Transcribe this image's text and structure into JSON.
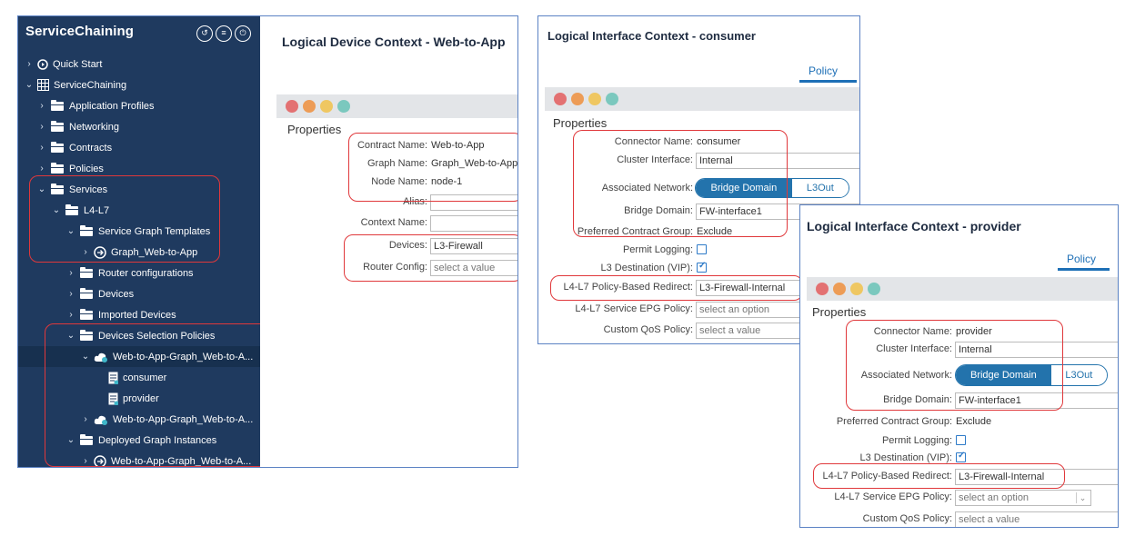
{
  "tree": {
    "title": "ServiceChaining",
    "toolbar_icons": [
      "refresh-settings-icon",
      "list-icon",
      "power-icon"
    ],
    "items": [
      {
        "label": "Quick Start",
        "icon": "play-icon",
        "chevron": "right"
      },
      {
        "label": "ServiceChaining",
        "icon": "grid-icon",
        "chevron": "down"
      },
      {
        "label": "Application Profiles",
        "icon": "folder-icon",
        "chevron": "right"
      },
      {
        "label": "Networking",
        "icon": "folder-icon",
        "chevron": "right"
      },
      {
        "label": "Contracts",
        "icon": "folder-icon",
        "chevron": "right"
      },
      {
        "label": "Policies",
        "icon": "folder-icon",
        "chevron": "right"
      },
      {
        "label": "Services",
        "icon": "folder-icon",
        "chevron": "down"
      },
      {
        "label": "L4-L7",
        "icon": "folder-icon",
        "chevron": "down"
      },
      {
        "label": "Service Graph Templates",
        "icon": "folder-icon",
        "chevron": "down"
      },
      {
        "label": "Graph_Web-to-App",
        "icon": "service-graph-icon",
        "chevron": "right"
      },
      {
        "label": "Router configurations",
        "icon": "folder-icon",
        "chevron": "right"
      },
      {
        "label": "Devices",
        "icon": "folder-icon",
        "chevron": "right"
      },
      {
        "label": "Imported Devices",
        "icon": "folder-icon",
        "chevron": "right"
      },
      {
        "label": "Devices Selection Policies",
        "icon": "folder-icon",
        "chevron": "down"
      },
      {
        "label": "Web-to-App-Graph_Web-to-A...",
        "icon": "cloud-policy-icon",
        "chevron": "down"
      },
      {
        "label": "consumer",
        "icon": "document-icon",
        "chevron": ""
      },
      {
        "label": "provider",
        "icon": "document-icon",
        "chevron": ""
      },
      {
        "label": "Web-to-App-Graph_Web-to-A...",
        "icon": "cloud-policy-icon",
        "chevron": "right"
      },
      {
        "label": "Deployed Graph Instances",
        "icon": "folder-icon",
        "chevron": "down"
      },
      {
        "label": "Web-to-App-Graph_Web-to-A...",
        "icon": "service-graph-icon",
        "chevron": "right"
      }
    ]
  },
  "device_context": {
    "title": "Logical Device Context - Web-to-App",
    "properties_label": "Properties",
    "fields": {
      "contract_name": {
        "label": "Contract Name:",
        "value": "Web-to-App"
      },
      "graph_name": {
        "label": "Graph Name:",
        "value": "Graph_Web-to-App"
      },
      "node_name": {
        "label": "Node Name:",
        "value": "node-1"
      },
      "alias": {
        "label": "Alias:",
        "value": ""
      },
      "context_name": {
        "label": "Context Name:",
        "value": ""
      },
      "devices": {
        "label": "Devices:",
        "value": "L3-Firewall"
      },
      "router_config": {
        "label": "Router Config:",
        "placeholder": "select a value"
      }
    }
  },
  "consumer_context": {
    "title": "Logical Interface Context - consumer",
    "tab": "Policy",
    "properties_label": "Properties",
    "fields": {
      "connector_name": {
        "label": "Connector Name:",
        "value": "consumer"
      },
      "cluster_interface": {
        "label": "Cluster Interface:",
        "value": "Internal"
      },
      "associated_network": {
        "label": "Associated Network:",
        "options": [
          "Bridge Domain",
          "L3Out"
        ],
        "selected": "Bridge Domain"
      },
      "bridge_domain": {
        "label": "Bridge Domain:",
        "value": "FW-interface1"
      },
      "preferred_contract_group": {
        "label": "Preferred Contract Group:",
        "value": "Exclude"
      },
      "permit_logging": {
        "label": "Permit Logging:",
        "checked": false
      },
      "l3_destination": {
        "label": "L3 Destination (VIP):",
        "checked": true
      },
      "pbr": {
        "label": "L4-L7 Policy-Based Redirect:",
        "value": "L3-Firewall-Internal"
      },
      "service_epg_policy": {
        "label": "L4-L7 Service EPG Policy:",
        "placeholder": "select an option"
      },
      "custom_qos": {
        "label": "Custom QoS Policy:",
        "placeholder": "select a value"
      }
    }
  },
  "provider_context": {
    "title": "Logical Interface Context - provider",
    "tab": "Policy",
    "properties_label": "Properties",
    "fields": {
      "connector_name": {
        "label": "Connector Name:",
        "value": "provider"
      },
      "cluster_interface": {
        "label": "Cluster Interface:",
        "value": "Internal"
      },
      "associated_network": {
        "label": "Associated Network:",
        "options": [
          "Bridge Domain",
          "L3Out"
        ],
        "selected": "Bridge Domain"
      },
      "bridge_domain": {
        "label": "Bridge Domain:",
        "value": "FW-interface1"
      },
      "preferred_contract_group": {
        "label": "Preferred Contract Group:",
        "value": "Exclude"
      },
      "permit_logging": {
        "label": "Permit Logging:",
        "checked": false
      },
      "l3_destination": {
        "label": "L3 Destination (VIP):",
        "checked": true
      },
      "pbr": {
        "label": "L4-L7 Policy-Based Redirect:",
        "value": "L3-Firewall-Internal"
      },
      "service_epg_policy": {
        "label": "L4-L7 Service EPG Policy:",
        "placeholder": "select an option"
      },
      "custom_qos": {
        "label": "Custom QoS Policy:",
        "placeholder": "select a value"
      }
    }
  },
  "fault_icons": [
    "critical-fault-icon",
    "major-fault-icon",
    "minor-fault-icon",
    "warning-fault-icon"
  ],
  "colors": {
    "sidebar_bg": "#1f3a5f",
    "accent": "#2373ac",
    "highlight": "#e0383b",
    "panel_border": "#5b82c4"
  }
}
